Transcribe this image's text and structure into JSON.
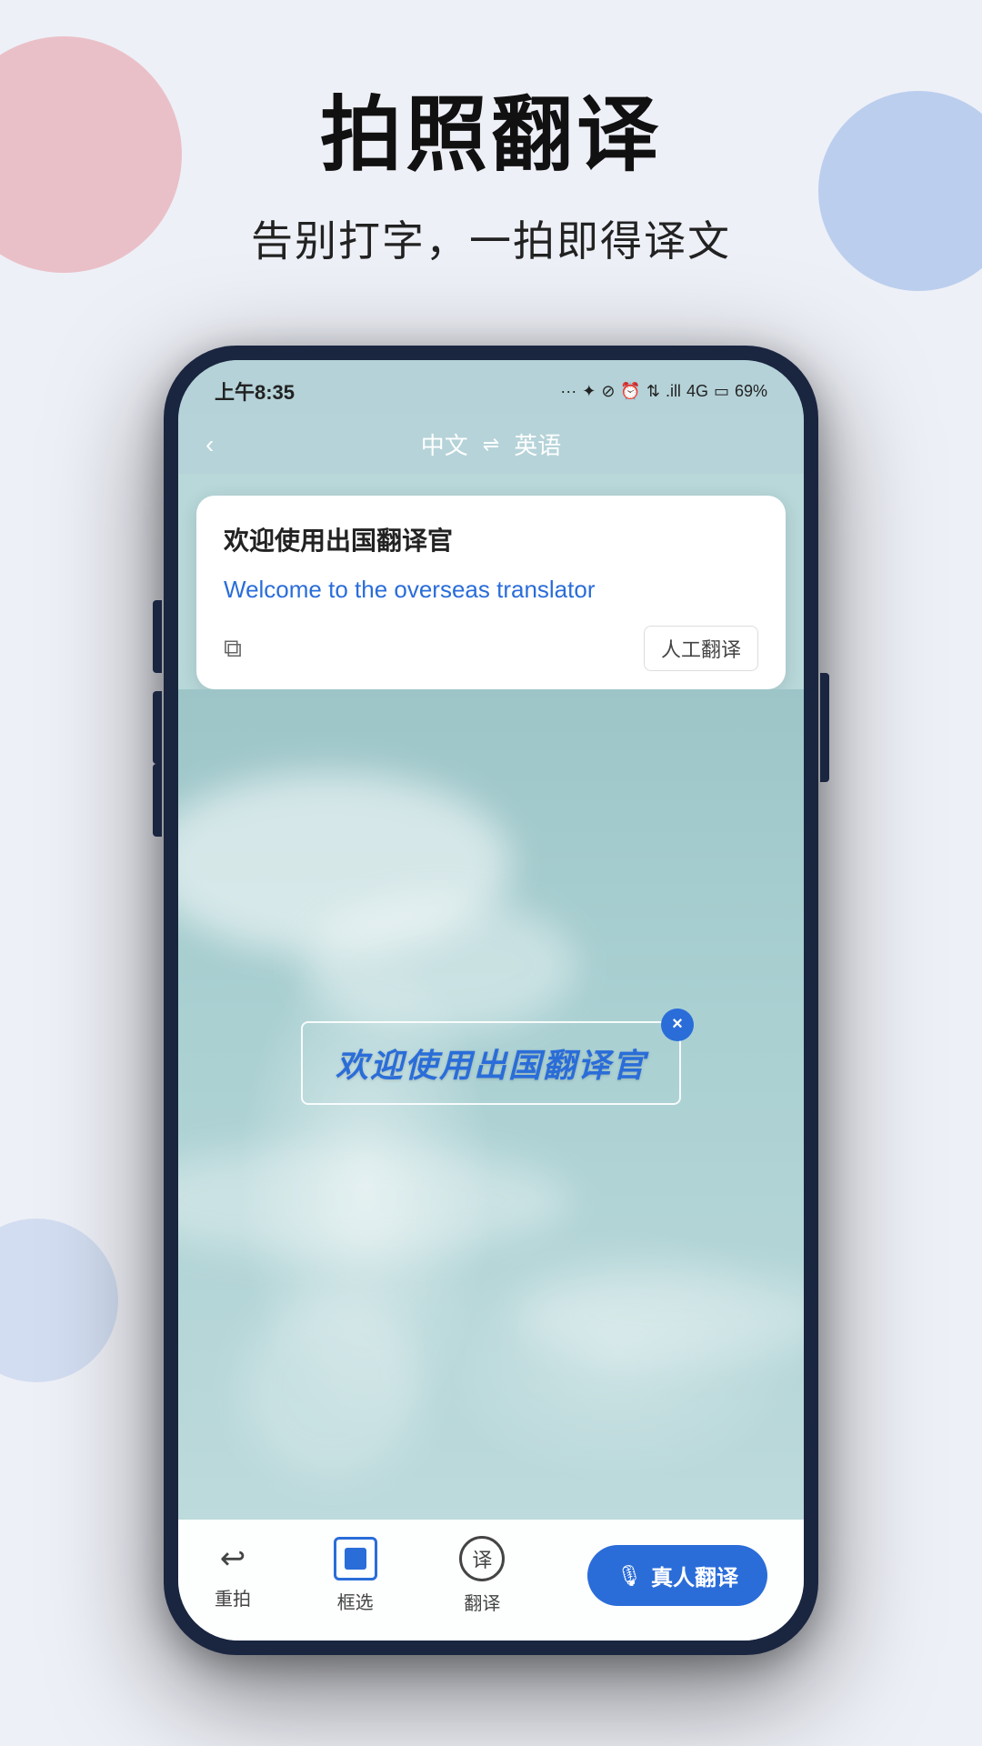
{
  "page": {
    "background_color": "#eef0f7"
  },
  "header": {
    "main_title": "拍照翻译",
    "sub_title": "告别打字，一拍即得译文"
  },
  "phone": {
    "status_bar": {
      "time": "上午8:35",
      "icons": "... ✦ ⊘ ⏰ ↕ .ill 4G",
      "battery": "69%"
    },
    "nav": {
      "back_icon": "‹",
      "source_lang": "中文",
      "swap_icon": "⇌",
      "target_lang": "英语"
    },
    "translation_card": {
      "original_text": "欢迎使用出国翻译官",
      "translated_text": "Welcome to the overseas translator",
      "copy_icon": "⧉",
      "human_translate_label": "人工翻译"
    },
    "camera_area": {
      "selected_text": "欢迎使用出国翻译官",
      "close_icon": "×"
    },
    "bottom_toolbar": {
      "retake_label": "重拍",
      "select_label": "框选",
      "translate_label": "翻译",
      "real_translate_label": "真人翻译"
    }
  }
}
